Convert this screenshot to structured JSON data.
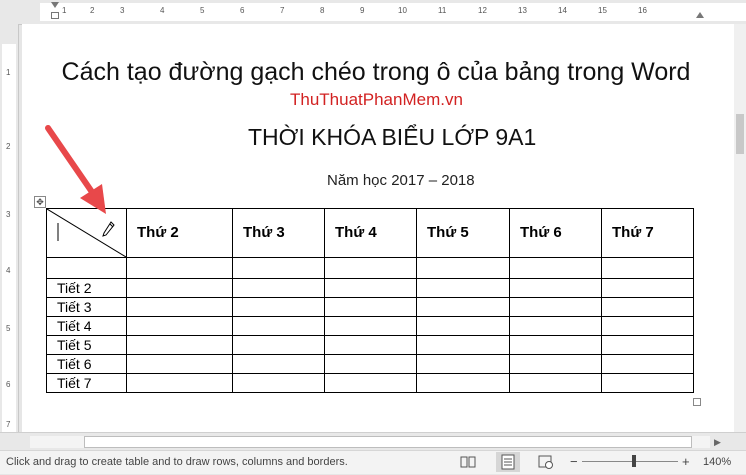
{
  "ruler": {
    "h_numbers": [
      "1",
      "2",
      "3",
      "4",
      "5",
      "6",
      "7",
      "8",
      "9",
      "10",
      "11",
      "12",
      "13",
      "14",
      "15",
      "16"
    ],
    "v_numbers": [
      "1",
      "2",
      "3",
      "4",
      "5",
      "6",
      "7"
    ]
  },
  "doc": {
    "title": "Cách tạo đường gạch chéo trong ô của bảng trong Word",
    "site": "ThuThuatPhanMem.vn",
    "heading": "THỜI KHÓA BIỂU LỚP 9A1",
    "subtitle": "Năm học 2017 – 2018"
  },
  "table": {
    "headers": [
      "Thứ 2",
      "Thứ 3",
      "Thứ 4",
      "Thứ 5",
      "Thứ 6",
      "Thứ 7"
    ],
    "rows": [
      "Tiết 2",
      "Tiết 3",
      "Tiết 4",
      "Tiết 5",
      "Tiết 6",
      "Tiết 7"
    ]
  },
  "status": {
    "message": "Click and drag to create table and to draw rows, columns and borders.",
    "zoom": "140%"
  },
  "icons": [
    "read-mode-icon",
    "print-layout-icon",
    "web-layout-icon",
    "pencil-cursor-icon",
    "table-move-handle-icon",
    "table-resize-handle-icon",
    "zoom-minus-icon",
    "zoom-plus-icon"
  ],
  "colors": {
    "site": "#d22222",
    "arrow": "#e8484a"
  }
}
